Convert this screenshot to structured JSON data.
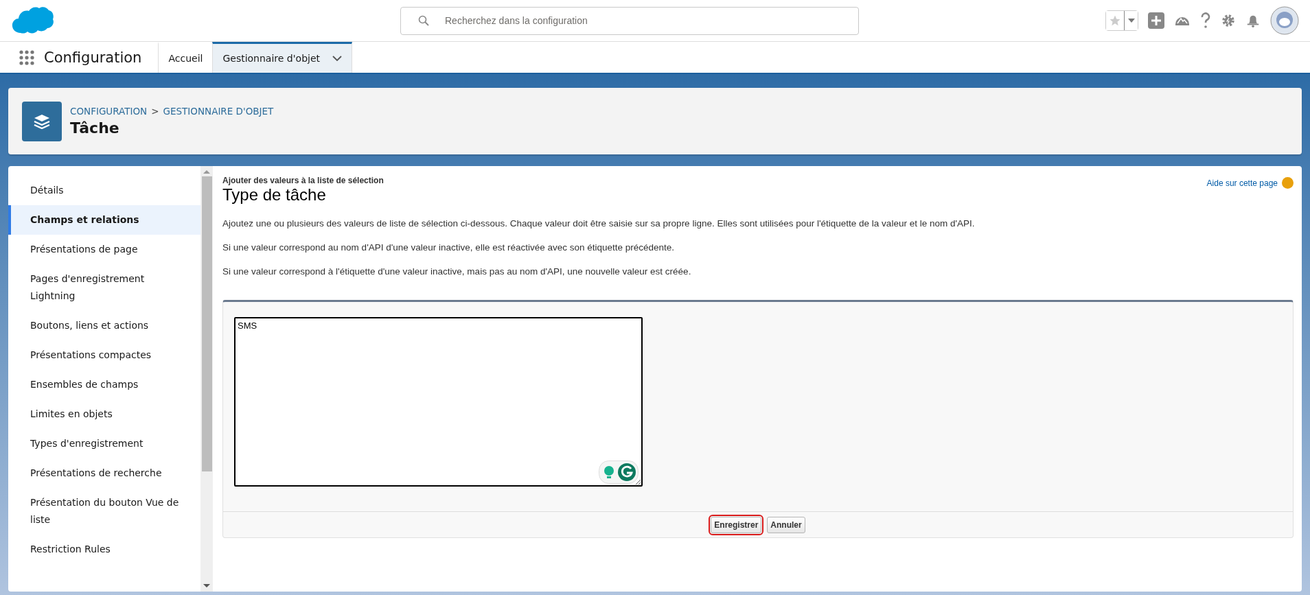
{
  "top_bar": {
    "search": {
      "placeholder": "Recherchez dans la configuration"
    }
  },
  "nav": {
    "app_name": "Configuration",
    "tabs": [
      {
        "label": "Accueil",
        "selected": false,
        "dropdown": false
      },
      {
        "label": "Gestionnaire d'objet",
        "selected": true,
        "dropdown": true
      }
    ]
  },
  "page_header": {
    "breadcrumbs": [
      "CONFIGURATION",
      "GESTIONNAIRE D'OBJET"
    ],
    "separator": ">",
    "title": "Tâche"
  },
  "sidebar": {
    "items": [
      {
        "label": "Détails",
        "selected": false
      },
      {
        "label": "Champs et relations",
        "selected": true
      },
      {
        "label": "Présentations de page",
        "selected": false
      },
      {
        "label": "Pages d'enregistrement Lightning",
        "selected": false
      },
      {
        "label": "Boutons, liens et actions",
        "selected": false
      },
      {
        "label": "Présentations compactes",
        "selected": false
      },
      {
        "label": "Ensembles de champs",
        "selected": false
      },
      {
        "label": "Limites en objets",
        "selected": false
      },
      {
        "label": "Types d'enregistrement",
        "selected": false
      },
      {
        "label": "Présentations de recherche",
        "selected": false
      },
      {
        "label": "Présentation du bouton Vue de liste",
        "selected": false
      },
      {
        "label": "Restriction Rules",
        "selected": false
      }
    ]
  },
  "content": {
    "subtitle": "Ajouter des valeurs à la liste de sélection",
    "title": "Type de tâche",
    "help_link": "Aide sur cette page",
    "paragraphs": [
      "Ajoutez une ou plusieurs des valeurs de liste de sélection ci-dessous. Chaque valeur doit être saisie sur sa propre ligne. Elles sont utilisées pour l'étiquette de la valeur et le nom d'API.",
      "Si une valeur correspond au nom d'API d'une valeur inactive, elle est réactivée avec son étiquette précédente.",
      "Si une valeur correspond à l'étiquette d'une valeur inactive, mais pas au nom d'API, une nouvelle valeur est créée."
    ],
    "values_field": {
      "value": "SMS"
    },
    "buttons": [
      {
        "label": "Enregistrer",
        "focused": true
      },
      {
        "label": "Annuler",
        "focused": false
      }
    ]
  }
}
